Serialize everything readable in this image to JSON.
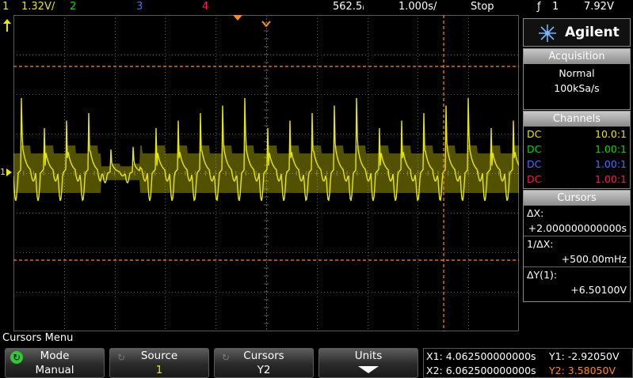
{
  "topbar": {
    "ch1_num": "1",
    "ch1_scale": "1.32V/",
    "ch2_num": "2",
    "ch3_num": "3",
    "ch4_num": "4",
    "delay": "562.5ᵢ",
    "timebase": "1.000s/",
    "run_state": "Stop",
    "trigger_icon": "rising-edge-trigger-icon",
    "trigger_symbol": "ƒ",
    "trigger_channel": "1",
    "trigger_level": "7.92V"
  },
  "brand": {
    "name": "Agilent",
    "logo_icon": "agilent-spark-icon"
  },
  "acquisition": {
    "title": "Acquisition",
    "mode": "Normal",
    "rate": "100kSa/s"
  },
  "channels": {
    "title": "Channels",
    "rows": [
      {
        "coupling": "DC",
        "probe": "10.0:1",
        "color": "#e8e800"
      },
      {
        "coupling": "DC",
        "probe": "1.00:1",
        "color": "#00e000"
      },
      {
        "coupling": "DC",
        "probe": "1.00:1",
        "color": "#4f6bff"
      },
      {
        "coupling": "DC",
        "probe": "1.00:1",
        "color": "#ff1a5a"
      }
    ]
  },
  "cursors": {
    "title": "Cursors",
    "dx_label": "ΔX:",
    "dx_value": "+2.000000000000s",
    "inv_dx_label": "1/ΔX:",
    "inv_dx_value": "+500.00mHz",
    "dy_label": "ΔY(1):",
    "dy_value": "+6.50100V"
  },
  "menu": {
    "title": "Cursors Menu",
    "softkeys": [
      {
        "label": "Mode",
        "value": "Manual"
      },
      {
        "label": "Source",
        "value": "1"
      },
      {
        "label": "Cursors",
        "value": "Y2"
      },
      {
        "label": "Units",
        "value": ""
      }
    ]
  },
  "readout": {
    "x1": "X1: 4.062500000000s",
    "x2": "X2: 6.062500000000s",
    "y1": "Y1: -2.92050V",
    "y2": "Y2: 3.58050V"
  },
  "colors": {
    "ch1": "#e8e800",
    "cursor": "#ff8a1a",
    "grid": "#5a5a5a"
  },
  "markers": {
    "ground_label": "1"
  }
}
